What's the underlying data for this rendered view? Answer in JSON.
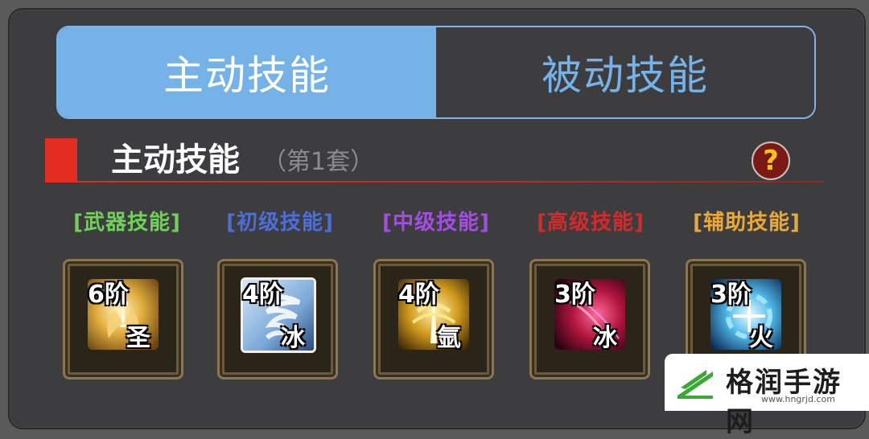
{
  "tabs": [
    {
      "label": "主动技能",
      "active": true
    },
    {
      "label": "被动技能",
      "active": false
    }
  ],
  "section": {
    "title": "主动技能",
    "subtitle": "（第1套）",
    "help_label": "?"
  },
  "categories": [
    {
      "label": "[武器技能]",
      "color": "#6fd05a"
    },
    {
      "label": "[初级技能]",
      "color": "#4d6ed8"
    },
    {
      "label": "[中级技能]",
      "color": "#a24ee0"
    },
    {
      "label": "[高级技能]",
      "color": "#d52a2a"
    },
    {
      "label": "[辅助技能]",
      "color": "#e8a93a"
    }
  ],
  "skills": [
    {
      "level": "6阶",
      "element": "圣",
      "icon": "holy-wings-icon"
    },
    {
      "level": "4阶",
      "element": "冰",
      "icon": "ice-whirlwind-icon"
    },
    {
      "level": "4阶",
      "element": "氩",
      "icon": "golden-blade-icon"
    },
    {
      "level": "3阶",
      "element": "冰",
      "icon": "crimson-slash-icon"
    },
    {
      "level": "3阶",
      "element": "火",
      "icon": "azure-vortex-icon"
    }
  ],
  "watermark": {
    "text": "格润手游网",
    "url": "www.hngrjd.com"
  }
}
